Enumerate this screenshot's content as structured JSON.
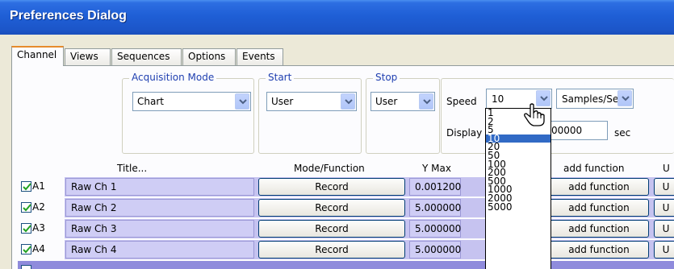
{
  "window": {
    "title": "Preferences Dialog"
  },
  "tabs": [
    {
      "label": "Channel",
      "active": true
    },
    {
      "label": "Views"
    },
    {
      "label": "Sequences"
    },
    {
      "label": "Options"
    },
    {
      "label": "Events"
    }
  ],
  "acquisition": {
    "label": "Acquisition Mode",
    "value": "Chart"
  },
  "start": {
    "label": "Start",
    "value": "User"
  },
  "stop": {
    "label": "Stop",
    "value": "User"
  },
  "speed": {
    "label": "Speed",
    "value": "10",
    "unit": "Samples/Sec",
    "options": [
      "1",
      "2",
      "5",
      "10",
      "20",
      "50",
      "100",
      "200",
      "500",
      "1000",
      "2000",
      "5000"
    ],
    "selected": "10"
  },
  "display": {
    "label": "Display",
    "value": "00000",
    "unit": "sec"
  },
  "columns": {
    "title": "Title...",
    "mode": "Mode/Function",
    "ymax": "Y Max",
    "addfn": "add function",
    "u": "U"
  },
  "rows": [
    {
      "id": "A1",
      "checked": true,
      "title": "Raw Ch 1",
      "mode": "Record",
      "ymax": "0.001200",
      "addfn": "add function",
      "u": "U"
    },
    {
      "id": "A2",
      "checked": true,
      "title": "Raw Ch 2",
      "mode": "Record",
      "ymax": "5.000000",
      "addfn": "add function",
      "u": "U"
    },
    {
      "id": "A3",
      "checked": true,
      "title": "Raw Ch 3",
      "mode": "Record",
      "ymax": "5.000000",
      "addfn": "add function",
      "u": "U"
    },
    {
      "id": "A4",
      "checked": true,
      "title": "Raw Ch 4",
      "mode": "Record",
      "ymax": "5.000000",
      "addfn": "add function",
      "u": "U"
    }
  ],
  "colors": {
    "titlebar": "#1f5fd6",
    "row": "#c6c3f0",
    "selected": "#316ac5",
    "group_label": "#1f3fb0"
  }
}
